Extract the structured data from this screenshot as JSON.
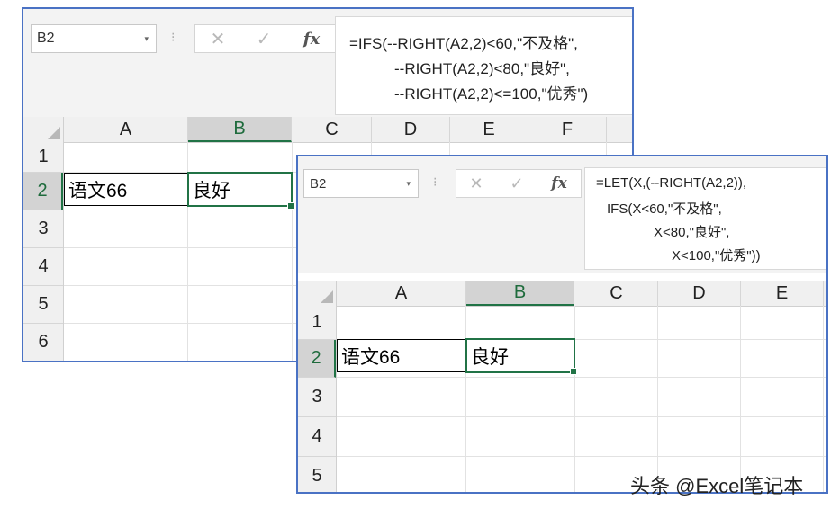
{
  "windows": [
    {
      "name_box": "B2",
      "formula_lines": [
        "=IFS(--RIGHT(A2,2)<60,\"不及格\",",
        "--RIGHT(A2,2)<80,\"良好\",",
        "--RIGHT(A2,2)<=100,\"优秀\")"
      ],
      "columns": [
        "A",
        "B",
        "C",
        "D",
        "E",
        "F"
      ],
      "rows": [
        "1",
        "2",
        "3",
        "4",
        "5",
        "6"
      ],
      "cells": {
        "A2": "语文66",
        "B2": "良好"
      }
    },
    {
      "name_box": "B2",
      "formula_lines": [
        "=LET(X,(--RIGHT(A2,2)),",
        "IFS(X<60,\"不及格\",",
        "X<80,\"良好\",",
        "X<100,\"优秀\"))"
      ],
      "columns": [
        "A",
        "B",
        "C",
        "D",
        "E"
      ],
      "rows": [
        "1",
        "2",
        "3",
        "4",
        "5"
      ],
      "cells": {
        "A2": "语文66",
        "B2": "良好"
      }
    }
  ],
  "icons": {
    "dropdown": "▾",
    "separator": "⁝",
    "cancel": "✕",
    "enter": "✓",
    "function": "fx"
  },
  "accent_color": "#217346",
  "window_border_color": "#4a72c4",
  "watermark": "头条 @Excel笔记本"
}
